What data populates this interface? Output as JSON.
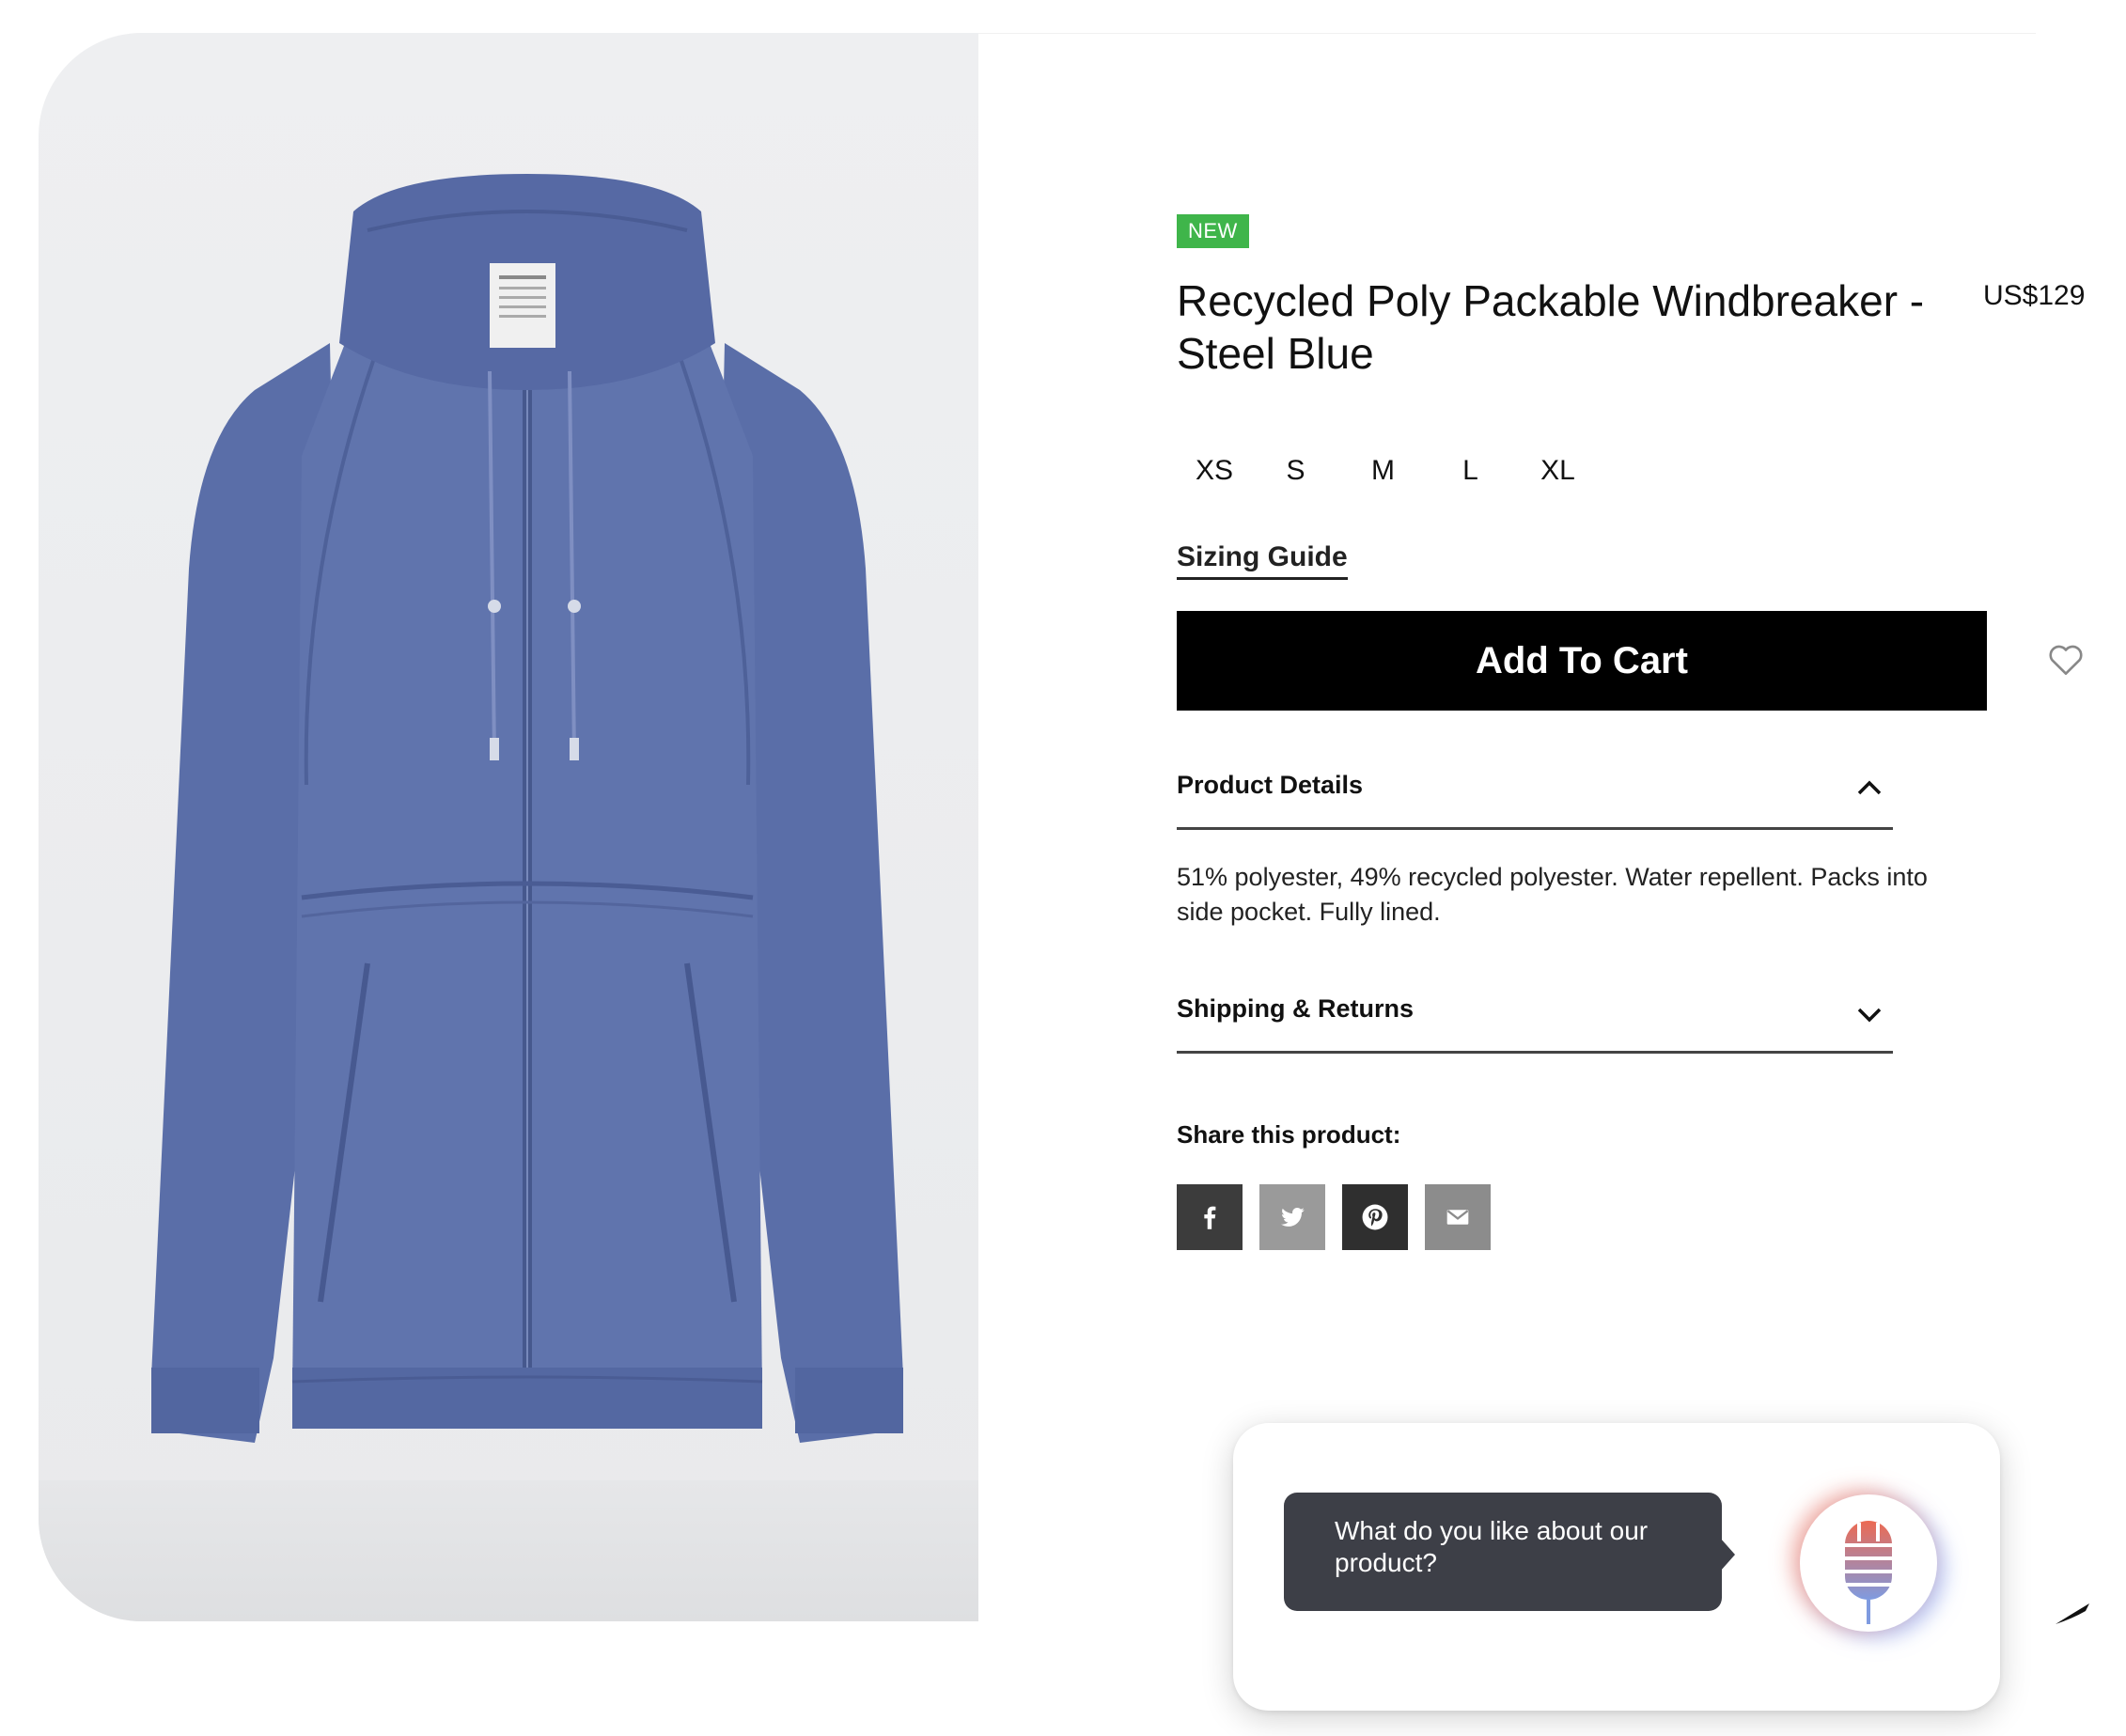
{
  "product": {
    "badge": "NEW",
    "title": "Recycled Poly Packable Windbreaker - Steel Blue",
    "price": "US$129",
    "color": "#5b6fa8"
  },
  "sizes": [
    "XS",
    "S",
    "M",
    "L",
    "XL"
  ],
  "sizing_guide_label": "Sizing Guide",
  "add_to_cart_label": "Add To Cart",
  "accordion": {
    "details_label": "Product Details",
    "details_text": "51% polyester, 49% recycled polyester. Water repellent. Packs into side pocket. Fully lined.",
    "shipping_label": "Shipping & Returns"
  },
  "share": {
    "label": "Share this product:",
    "buttons": [
      {
        "icon": "facebook-icon",
        "color": "#3c3c3c"
      },
      {
        "icon": "twitter-icon",
        "color": "#9a9a9a"
      },
      {
        "icon": "pinterest-icon",
        "color": "#2f2f2f"
      },
      {
        "icon": "email-icon",
        "color": "#8c8c8c"
      }
    ]
  },
  "voice_widget": {
    "prompt": "What do you like about our product?"
  },
  "colors": {
    "badge": "#3fb54a",
    "cta": "#000000",
    "bubble": "#3d3f47"
  }
}
